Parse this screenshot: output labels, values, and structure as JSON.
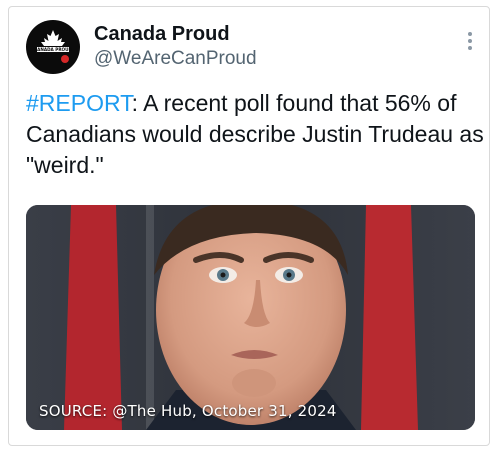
{
  "account": {
    "display_name": "Canada Proud",
    "handle": "@WeAreCanProud",
    "avatar_text": "CANADA PROUD"
  },
  "tweet": {
    "hashtag": "#REPORT",
    "text": ": A recent poll found that 56% of Canadians would describe Justin Trudeau as \"weird.\""
  },
  "media": {
    "caption": "SOURCE: @The Hub, October 31, 2024"
  },
  "colors": {
    "hashtag": "#1d9bf0",
    "text": "#0f1419",
    "secondary": "#536471"
  },
  "icons": {
    "more": "more-vertical-icon",
    "avatar_leaf": "maple-leaf-icon"
  }
}
